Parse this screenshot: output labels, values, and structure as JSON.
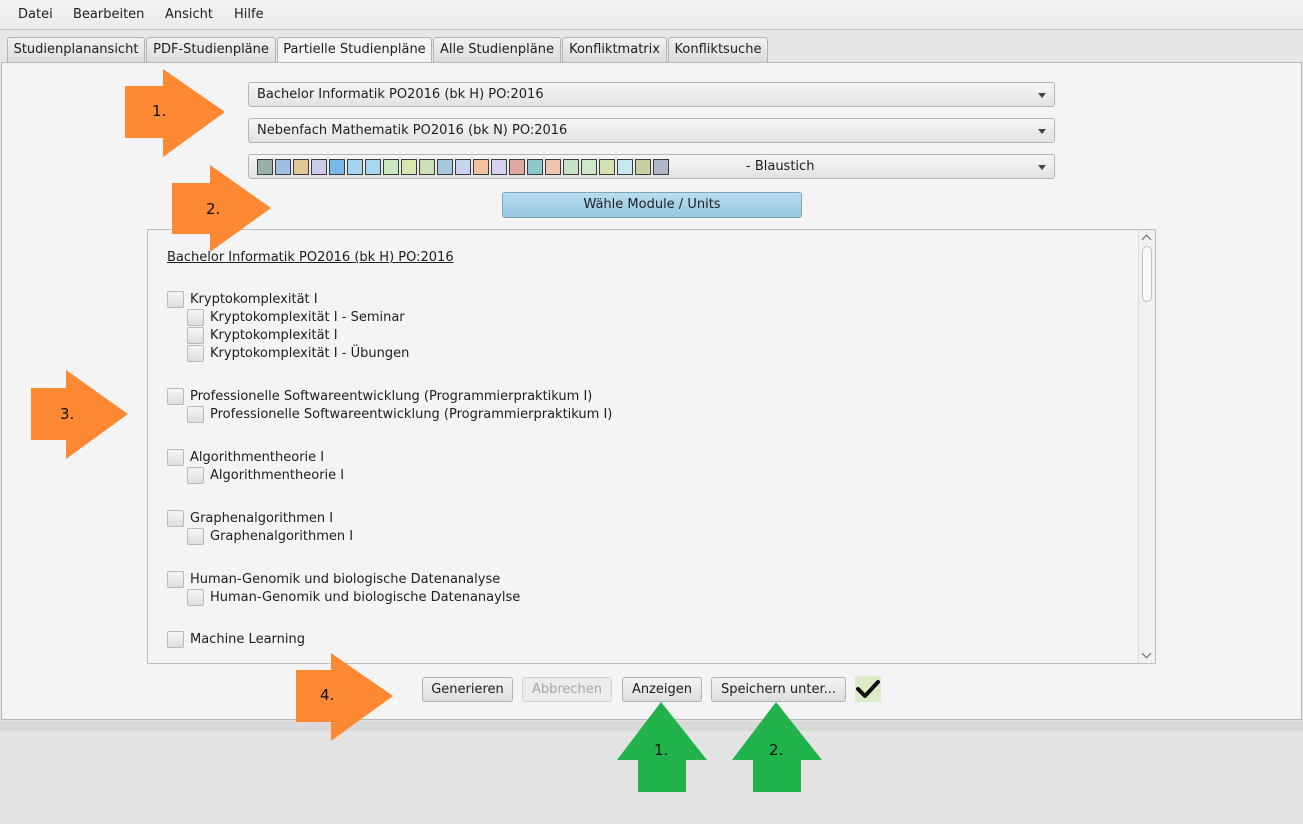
{
  "menu": [
    "Datei",
    "Bearbeiten",
    "Ansicht",
    "Hilfe"
  ],
  "tabs": [
    {
      "label": "Studienplanansicht",
      "active": false
    },
    {
      "label": "PDF-Studienpläne",
      "active": false
    },
    {
      "label": "Partielle Studienpläne",
      "active": true
    },
    {
      "label": "Alle Studienpläne",
      "active": false
    },
    {
      "label": "Konfliktmatrix",
      "active": false
    },
    {
      "label": "Konfliktsuche",
      "active": false
    }
  ],
  "combos": {
    "program": "Bachelor Informatik PO2016 (bk H) PO:2016",
    "minor": "Nebenfach Mathematik PO2016 (bk N) PO:2016",
    "palette_label": "- Blaustich",
    "palette_colors": [
      "#9ab0a8",
      "#9fc0e0",
      "#e0c896",
      "#c8cce8",
      "#7ab8e8",
      "#a8d4f0",
      "#a8d8f0",
      "#cce8c0",
      "#d8e8b0",
      "#cce0b8",
      "#a8c8e0",
      "#c8d4f0",
      "#f0c0a0",
      "#d8d0f0",
      "#e0a8a0",
      "#8cc8cc",
      "#f0c4b0",
      "#c8e0c8",
      "#cce8c8",
      "#d4e0b0",
      "#c8e8f0",
      "#c8d0a0",
      "#b0b8c8"
    ]
  },
  "choose_button": "Wähle Module / Units",
  "tree": {
    "heading": "Bachelor Informatik PO2016 (bk H) PO:2016",
    "modules": [
      {
        "label": "Kryptokomplexität I",
        "units": [
          "Kryptokomplexität I - Seminar",
          "Kryptokomplexität I",
          "Kryptokomplexität I - Übungen"
        ]
      },
      {
        "label": "Professionelle Softwareentwicklung (Programmierpraktikum I)",
        "units": [
          "Professionelle Softwareentwicklung (Programmierpraktikum I)"
        ]
      },
      {
        "label": "Algorithmentheorie I",
        "units": [
          "Algorithmentheorie I"
        ]
      },
      {
        "label": "Graphenalgorithmen I",
        "units": [
          "Graphenalgorithmen I"
        ]
      },
      {
        "label": "Human-Genomik und biologische Datenanalyse",
        "units": [
          "Human-Genomik und biologische Datenanaylse"
        ]
      },
      {
        "label": "Machine Learning",
        "units": []
      }
    ]
  },
  "buttons": {
    "generate": "Generieren",
    "cancel": "Abbrechen",
    "show": "Anzeigen",
    "save_as": "Speichern unter...",
    "status_icon": "check-icon"
  },
  "annotations": {
    "orange": [
      "1.",
      "2.",
      "3.",
      "4."
    ],
    "green": [
      "1.",
      "2."
    ],
    "orange_color": "#ff8833",
    "green_color": "#22b24c"
  }
}
